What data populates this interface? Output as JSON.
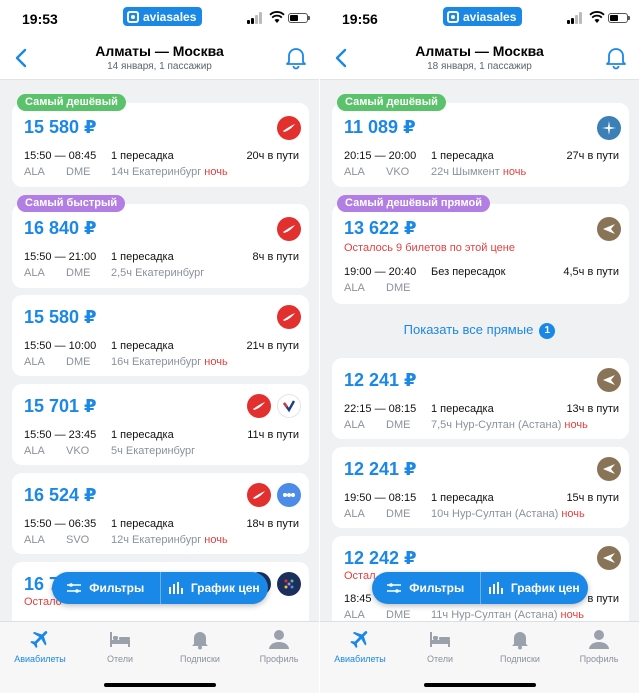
{
  "colors": {
    "accent": "#1a88e6",
    "cheapest_badge": "#5ac26a",
    "special_badge": "#b27ee3",
    "night": "#e64040"
  },
  "left": {
    "status": {
      "time": "19:53",
      "brand": "aviasales"
    },
    "nav": {
      "title": "Алматы — Москва",
      "subtitle": "14 января, 1 пассажир"
    },
    "cards": [
      {
        "badge": "Самый дешёвый",
        "price": "15 580 ₽",
        "dep": "15:50",
        "arr": "08:45",
        "stops": "1 пересадка",
        "duration": "20ч в пути",
        "from": "ALA",
        "to": "DME",
        "via": "14ч Екатеринбург",
        "night": "ночь"
      },
      {
        "badge": "Самый быстрый",
        "price": "16 840 ₽",
        "dep": "15:50",
        "arr": "21:00",
        "stops": "1 пересадка",
        "duration": "8ч в пути",
        "from": "ALA",
        "to": "DME",
        "via": "2,5ч Екатеринбург"
      },
      {
        "price": "15 580 ₽",
        "dep": "15:50",
        "arr": "10:00",
        "stops": "1 пересадка",
        "duration": "21ч в пути",
        "from": "ALA",
        "to": "DME",
        "via": "16ч Екатеринбург",
        "night": "ночь"
      },
      {
        "price": "15 701 ₽",
        "dep": "15:50",
        "arr": "23:45",
        "stops": "1 пересадка",
        "duration": "11ч в пути",
        "from": "ALA",
        "to": "VKO",
        "via": "5ч Екатеринбург"
      },
      {
        "price": "16 524 ₽",
        "dep": "15:50",
        "arr": "06:35",
        "stops": "1 пересадка",
        "duration": "18ч в пути",
        "from": "ALA",
        "to": "SVO",
        "via": "12ч Екатеринбург",
        "night": "ночь"
      },
      {
        "price": "16 7",
        "warning": "Остало"
      }
    ],
    "filters": {
      "filters_label": "Фильтры",
      "prices_label": "График цен"
    },
    "tabs": [
      "Авиабилеты",
      "Отели",
      "Подписки",
      "Профиль"
    ]
  },
  "right": {
    "status": {
      "time": "19:56",
      "brand": "aviasales"
    },
    "nav": {
      "title": "Алматы — Москва",
      "subtitle": "18 января, 1 пассажир"
    },
    "cards": [
      {
        "badge": "Самый дешёвый",
        "price": "11 089 ₽",
        "dep": "20:15",
        "arr": "20:00",
        "stops": "1 пересадка",
        "duration": "27ч в пути",
        "from": "ALA",
        "to": "VKO",
        "via": "22ч Шымкент",
        "night": "ночь"
      },
      {
        "badge": "Самый дешёвый прямой",
        "price": "13 622 ₽",
        "warning": "Осталось 9 билетов по этой цене",
        "dep": "19:00",
        "arr": "20:40",
        "stops": "Без пересадок",
        "duration": "4,5ч в пути",
        "from": "ALA",
        "to": "DME"
      },
      {
        "price": "12 241 ₽",
        "dep": "22:15",
        "arr": "08:15",
        "stops": "1 пересадка",
        "duration": "13ч в пути",
        "from": "ALA",
        "to": "DME",
        "via": "7,5ч Нур-Султан (Астана)",
        "night": "ночь"
      },
      {
        "price": "12 241 ₽",
        "dep": "19:50",
        "arr": "08:15",
        "stops": "1 пересадка",
        "duration": "15ч в пути",
        "from": "ALA",
        "to": "DME",
        "via": "10ч Нур-Султан (Астана)",
        "night": "ночь"
      },
      {
        "price": "12 242 ₽",
        "warning": "Остал",
        "dep": "18:45",
        "duration": "в пути",
        "from": "ALA",
        "to": "DME",
        "via": "11ч Нур-Султан (Астана)",
        "night": "ночь"
      }
    ],
    "show_direct": {
      "label": "Показать все прямые",
      "count": "1"
    },
    "filters": {
      "filters_label": "Фильтры",
      "prices_label": "График цен"
    },
    "tabs": [
      "Авиабилеты",
      "Отели",
      "Подписки",
      "Профиль"
    ]
  }
}
